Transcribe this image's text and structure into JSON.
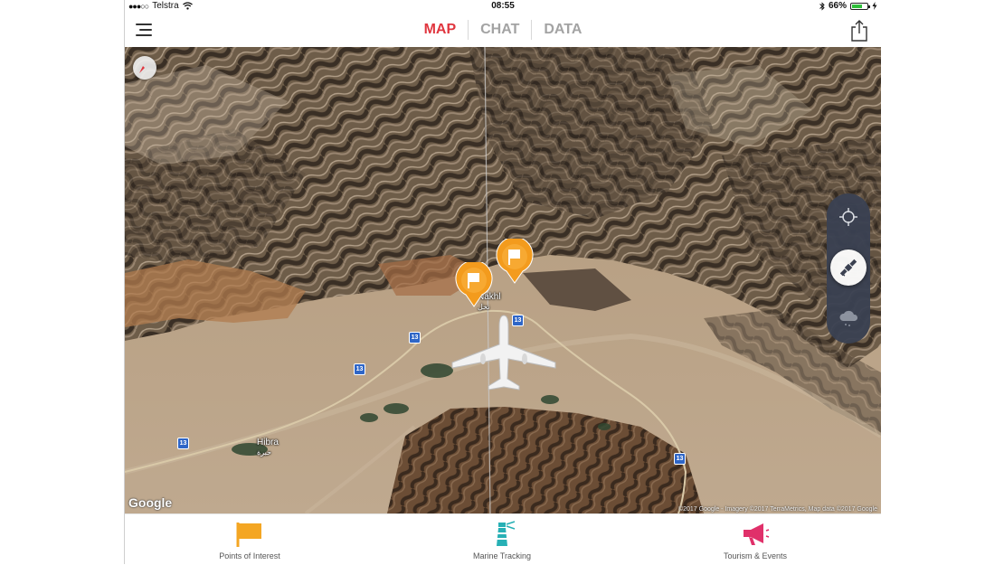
{
  "status_bar": {
    "signal_dots": "●●●○○",
    "carrier": "Telstra",
    "time": "08:55",
    "battery_percent": "66%",
    "battery_level": 0.66
  },
  "nav": {
    "tabs": [
      {
        "label": "MAP",
        "active": true
      },
      {
        "label": "CHAT",
        "active": false
      },
      {
        "label": "DATA",
        "active": false
      }
    ],
    "icons": {
      "menu": "menu-icon",
      "share": "share-icon"
    }
  },
  "map": {
    "view": "satellite",
    "places": [
      {
        "name": "Nakhl",
        "arabic": "نخل"
      },
      {
        "name": "Hibra",
        "arabic": "حبرة"
      }
    ],
    "route_label": "13",
    "poi_markers": 2,
    "provider_logo": "Google",
    "attribution": "©2017 Google - Imagery ©2017 TerraMetrics, Map data ©2017 Google",
    "controls": [
      {
        "name": "locate",
        "icon": "crosshair-icon",
        "active": false
      },
      {
        "name": "satellite",
        "icon": "satellite-icon",
        "active": true
      },
      {
        "name": "weather",
        "icon": "cloud-icon",
        "active": false
      }
    ],
    "colors": {
      "pin": "#f39b1d",
      "controls_bg": "#3a4152"
    }
  },
  "bottom_bar": {
    "items": [
      {
        "label": "Points of Interest",
        "icon": "flag-icon",
        "color": "#f4a623"
      },
      {
        "label": "Marine Tracking",
        "icon": "lighthouse-icon",
        "color": "#27b0b5"
      },
      {
        "label": "Tourism & Events",
        "icon": "megaphone-icon",
        "color": "#e0306a"
      }
    ]
  },
  "accent_color": "#e0363f"
}
